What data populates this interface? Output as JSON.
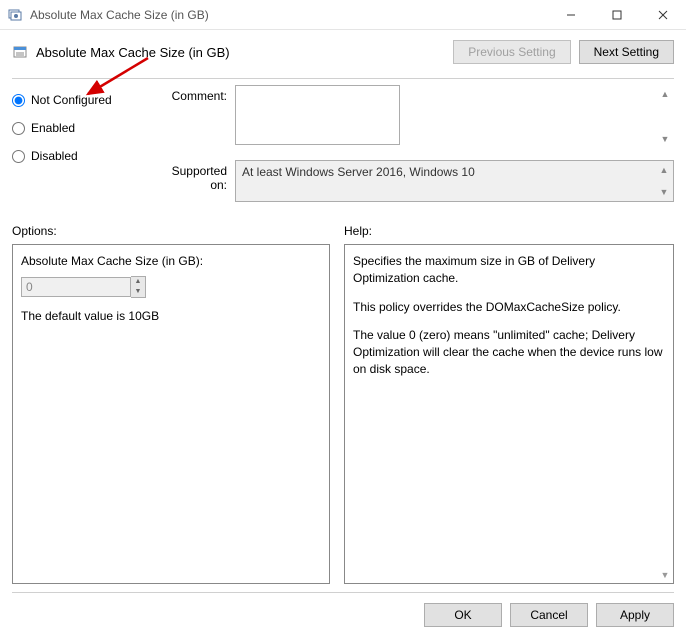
{
  "window": {
    "title": "Absolute Max Cache Size (in GB)"
  },
  "header": {
    "policy_title": "Absolute Max Cache Size (in GB)",
    "prev_btn": "Previous Setting",
    "next_btn": "Next Setting"
  },
  "radios": {
    "not_configured": "Not Configured",
    "enabled": "Enabled",
    "disabled": "Disabled",
    "selected": "not_configured"
  },
  "meta": {
    "comment_label": "Comment:",
    "comment_value": "",
    "supported_label": "Supported on:",
    "supported_value": "At least Windows Server 2016, Windows 10"
  },
  "options": {
    "panel_label": "Options:",
    "field_label": "Absolute Max Cache Size (in GB):",
    "field_value": "0",
    "note": "The default value is 10GB"
  },
  "help": {
    "panel_label": "Help:",
    "p1": "Specifies the maximum size in GB of Delivery Optimization cache.",
    "p2": "This policy overrides the DOMaxCacheSize policy.",
    "p3": "The value 0 (zero) means \"unlimited\" cache; Delivery Optimization will clear the cache when the device runs low on disk space."
  },
  "footer": {
    "ok": "OK",
    "cancel": "Cancel",
    "apply": "Apply"
  }
}
